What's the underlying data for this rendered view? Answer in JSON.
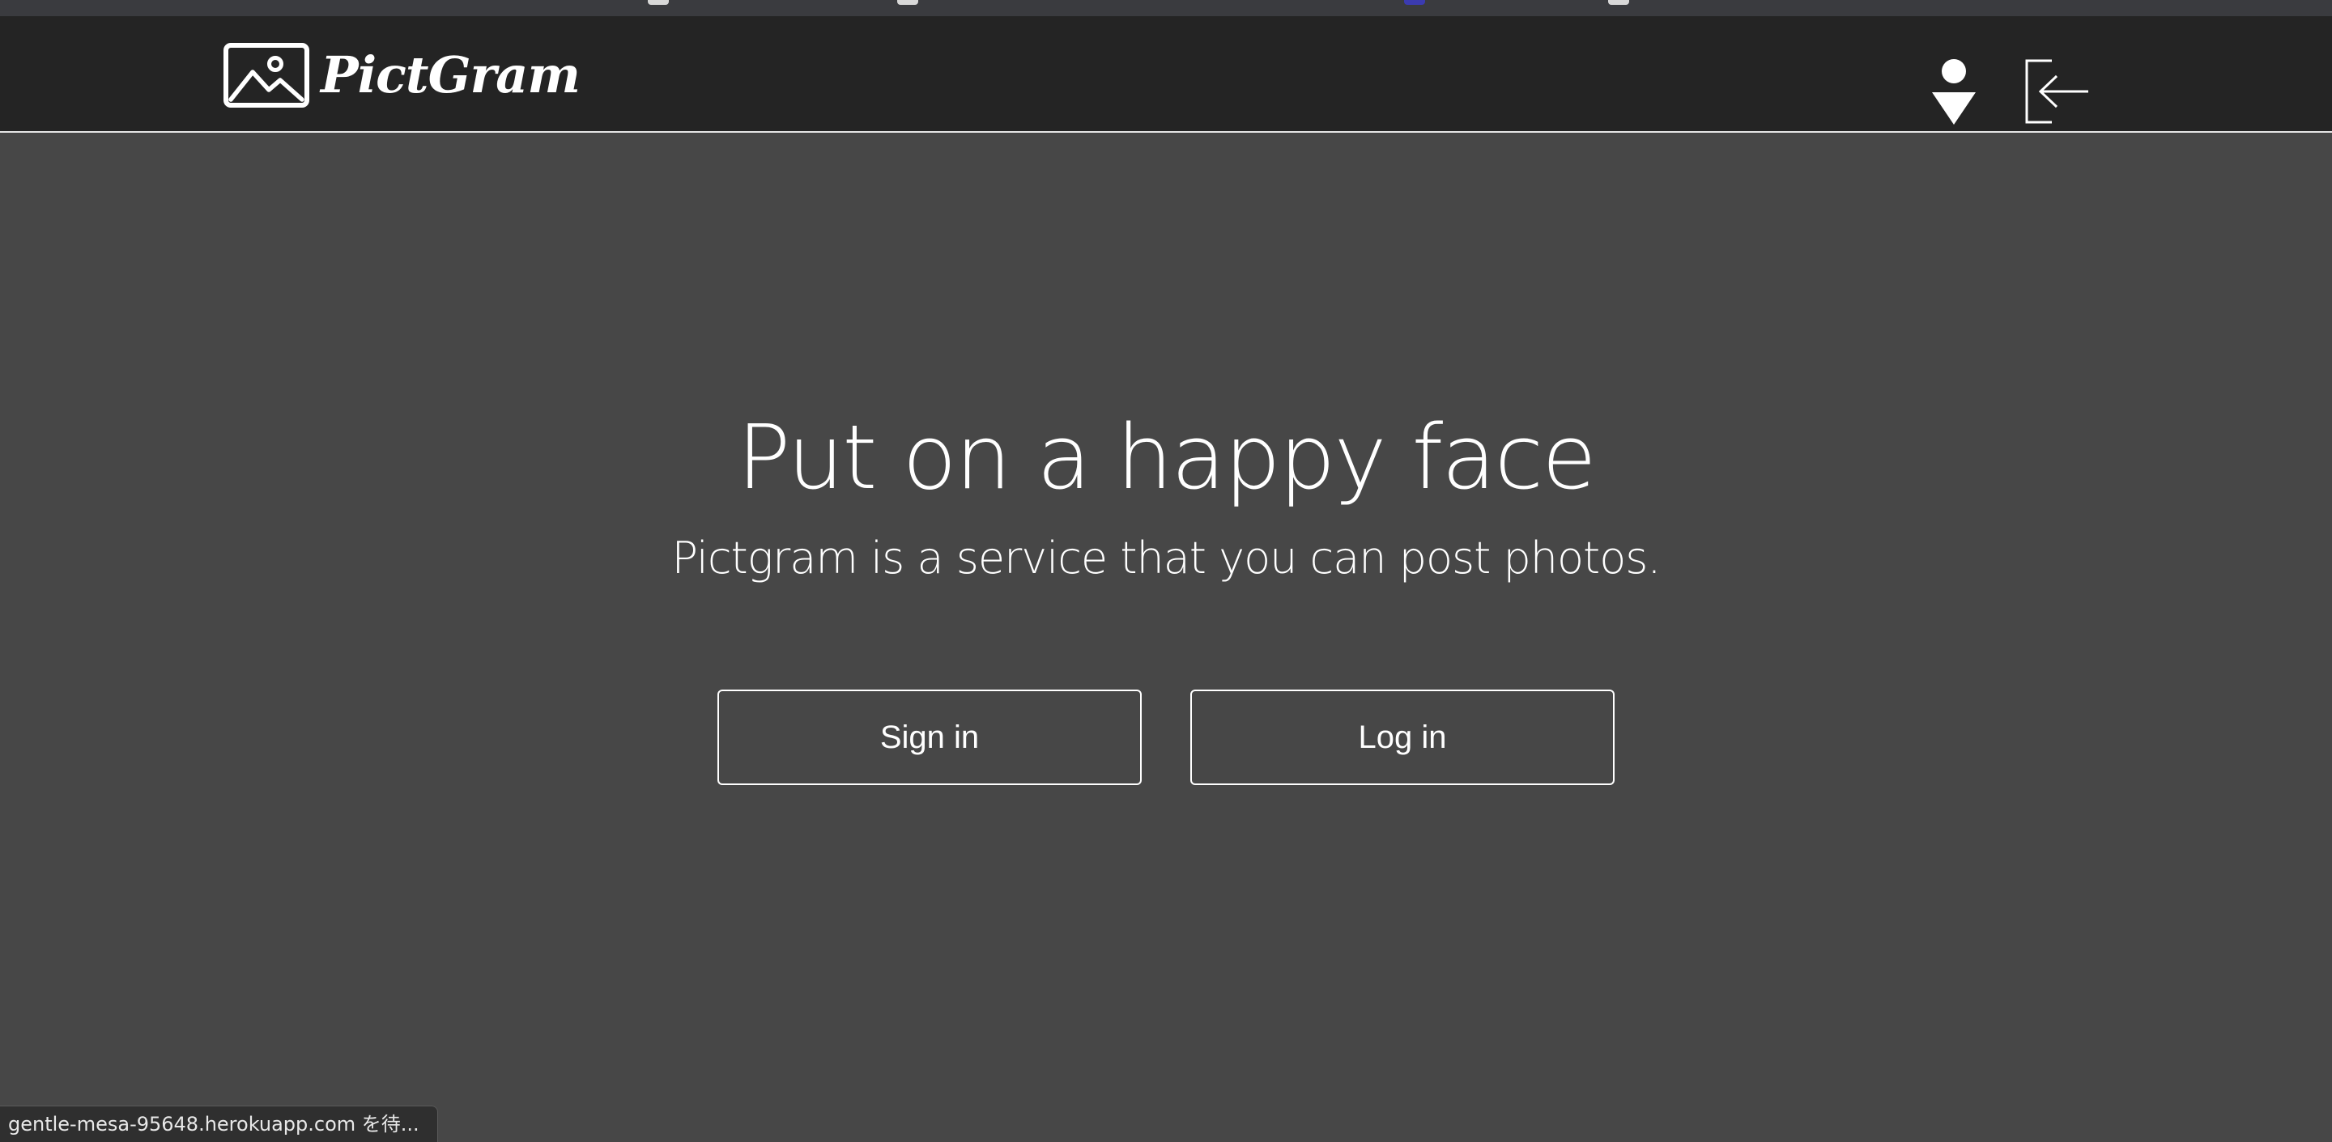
{
  "navbar": {
    "brand_name": "PictGram",
    "icons": {
      "brand_logo": "image-landscape-icon",
      "user": "user-icon",
      "login": "login-arrow-icon"
    }
  },
  "hero": {
    "title": "Put on a happy face",
    "subtitle": "Pictgram is a service that you can post photos."
  },
  "buttons": {
    "sign_in_label": "Sign in",
    "log_in_label": "Log in"
  },
  "status_bar": {
    "text": "gentle-mesa-95648.herokuapp.com を待..."
  },
  "colors": {
    "page_background": "#474747",
    "navbar_background": "#242424",
    "foreground": "#ffffff"
  }
}
